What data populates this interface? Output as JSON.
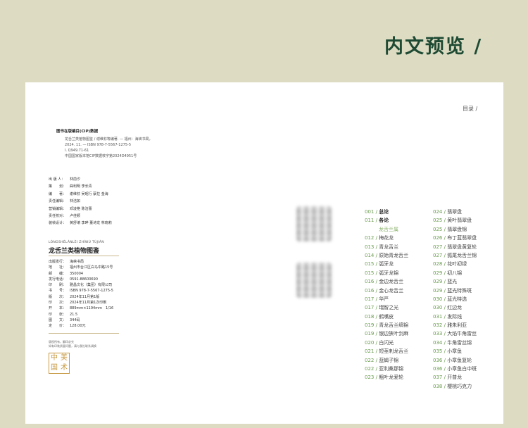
{
  "header": {
    "title": "内文预览 /"
  },
  "cip": {
    "title": "图书在版编目(CIP)数据",
    "lines": [
      "龙舌兰类植物图鉴 / 谢维荪等编著. — 福州：海峡书局，",
      "2024. 11. — ISBN 978-7-5567-1275-5",
      "Ⅰ. Q949.71-61",
      "中国国家版本馆CIP数据核字第2024D4951号"
    ]
  },
  "credits": [
    {
      "k": "出 版 人：",
      "v": "林前汐"
    },
    {
      "k": "策　　划：",
      "v": "曲利明 李长青"
    },
    {
      "k": "编　　著：",
      "v": "谢维荪 吴昭行 蔡拉 金海"
    },
    {
      "k": "责任编辑：",
      "v": "林洁如"
    },
    {
      "k": "营销编辑：",
      "v": "邓凌艳 陈洁蕾"
    },
    {
      "k": "责任校对：",
      "v": "卢佳颖"
    },
    {
      "k": "装帧设计：",
      "v": "黄舒堉 李晔 董诗龙 林晓莉"
    }
  ],
  "book": {
    "pinyin": "LÓNGSHÉLÁNLÈI ZHÍWÙ TÚJIÀN",
    "title": "龙舌兰类植物图鉴"
  },
  "publication": [
    {
      "k": "出版发行：",
      "v": "海峡书局"
    },
    {
      "k": "地　　址：",
      "v": "福州市台江区白马中路15号"
    },
    {
      "k": "邮　　编：",
      "v": "350004"
    },
    {
      "k": "发行电话：",
      "v": "0591-88600690"
    },
    {
      "k": "印　　刷：",
      "v": "雅昌文化（集团）有限公司"
    },
    {
      "k": "书　　号：",
      "v": "ISBN 978-7-5567-1275-5"
    },
    {
      "k": "版　　次：",
      "v": "2024年11月第1版"
    },
    {
      "k": "印　　次：",
      "v": "2024年11月第1次印刷"
    },
    {
      "k": "开　　本：",
      "v": "889mm×1194mm　1/16"
    },
    {
      "k": "印　　张：",
      "v": "21.5"
    },
    {
      "k": "图　　文：",
      "v": "344码"
    },
    {
      "k": "定　　价：",
      "v": "128.00元"
    }
  ],
  "notice": [
    "版权所有，翻印必究",
    "如有印装质量问题，请与我社联系调换"
  ],
  "seal": [
    "中",
    "国",
    "美",
    "术"
  ],
  "toc": {
    "heading": "目录 /",
    "col1": [
      {
        "num": "001",
        "txt": "总论",
        "bold": true
      },
      {
        "num": "011",
        "txt": "各论",
        "bold": true
      },
      {
        "section": "龙舌兰属"
      },
      {
        "num": "012",
        "txt": "梅花龙"
      },
      {
        "num": "013",
        "txt": "青龙舌兰"
      },
      {
        "num": "014",
        "txt": "原始青龙舌兰"
      },
      {
        "num": "015",
        "txt": "弧牙龙"
      },
      {
        "num": "015",
        "txt": "弧牙龙锦"
      },
      {
        "num": "016",
        "txt": "金边龙舌兰"
      },
      {
        "num": "016",
        "txt": "金心龙舌兰"
      },
      {
        "num": "017",
        "txt": "华严"
      },
      {
        "num": "017",
        "txt": "瑞智之光"
      },
      {
        "num": "018",
        "txt": "鹤嘴皮"
      },
      {
        "num": "019",
        "txt": "青龙舌兰缟锦"
      },
      {
        "num": "019",
        "txt": "银边狭叶剑麻"
      },
      {
        "num": "020",
        "txt": "白闪光"
      },
      {
        "num": "021",
        "txt": "短茎刺龙舌兰"
      },
      {
        "num": "022",
        "txt": "蓝蝎子锦"
      },
      {
        "num": "022",
        "txt": "亚利桑那锦"
      },
      {
        "num": "023",
        "txt": "粗叶龙爱轮"
      }
    ],
    "col2": [
      {
        "num": "024",
        "txt": "翡翠盘"
      },
      {
        "num": "025",
        "txt": "黄叶翡翠盘"
      },
      {
        "num": "025",
        "txt": "翡翠盘锦"
      },
      {
        "num": "026",
        "txt": "布丁蓝翡翠盘"
      },
      {
        "num": "027",
        "txt": "翡翠盘黄复轮"
      },
      {
        "num": "027",
        "txt": "狐尾龙舌兰锦"
      },
      {
        "num": "028",
        "txt": "花叶初绿"
      },
      {
        "num": "029",
        "txt": "初八锦"
      },
      {
        "num": "029",
        "txt": "蓝光"
      },
      {
        "num": "029",
        "txt": "蓝光特殊斑"
      },
      {
        "num": "030",
        "txt": "蓝光特选"
      },
      {
        "num": "030",
        "txt": "红边龙"
      },
      {
        "num": "031",
        "txt": "发际线"
      },
      {
        "num": "032",
        "txt": "雅朱利亚"
      },
      {
        "num": "033",
        "txt": "大焰牛角雷丝"
      },
      {
        "num": "034",
        "txt": "牛角雷丝锦"
      },
      {
        "num": "035",
        "txt": "小章鱼"
      },
      {
        "num": "036",
        "txt": "小章鱼复轮"
      },
      {
        "num": "036",
        "txt": "小章鱼白中斑"
      },
      {
        "num": "037",
        "txt": "开普龙"
      },
      {
        "num": "038",
        "txt": "樱桃巧克力"
      }
    ]
  }
}
